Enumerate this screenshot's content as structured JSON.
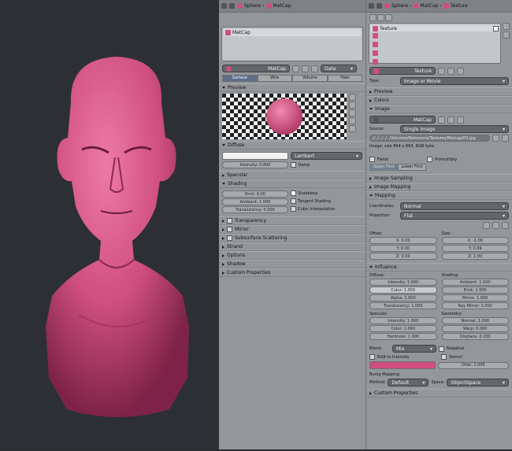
{
  "material_panel": {
    "crumbs": [
      "Sphere",
      "MatCap"
    ],
    "slot": "MatCap",
    "mat_name": "MatCap",
    "data": "Data",
    "tabs": [
      "Surface",
      "Wire",
      "Volume",
      "Halo"
    ],
    "preview": "Preview",
    "diffuse": "Diffuse",
    "diffuse_shader": "Lambert",
    "diffuse_intensity": "Intensity: 0.800",
    "ramp": "Ramp",
    "specular": "Specular",
    "shading": "Shading",
    "emit": "Emit: 0.00",
    "ambient": "Ambient: 1.000",
    "translucency": "Translucency: 0.000",
    "shadeless": "Shadeless",
    "tangent": "Tangent Shading",
    "cubic": "Cubic Interpolation",
    "sections": [
      "Transparency",
      "Mirror",
      "Subsurface Scattering",
      "Strand",
      "Options",
      "Shadow",
      "Custom Properties"
    ]
  },
  "texture_panel": {
    "crumbs": [
      "Sphere",
      "MatCap",
      "Texture"
    ],
    "slot": "Texture",
    "tex_name": "Texture",
    "type_label": "Type:",
    "type_value": "Image or Movie",
    "sec_preview": "Preview",
    "sec_colors": "Colors",
    "sec_image": "Image",
    "image_name": "MatCap",
    "source_label": "Source:",
    "source_value": "Single Image",
    "path": "//../../../../Volumes/Reference/Textures/Matcap/P2.jpg",
    "image_info": "Image: size 864 x 864, RGB byte",
    "fields": "Fields",
    "premultiply": "Premultiply",
    "upper_first": "Upper First",
    "lower_first": "Lower First",
    "sec_sampling": "Image Sampling",
    "sec_imap": "Image Mapping",
    "sec_mapping": "Mapping",
    "coords_label": "Coordinates:",
    "coords_value": "Normal",
    "proj_label": "Projection:",
    "proj_value": "Flat",
    "offset_label": "Offset:",
    "size_label": "Size:",
    "offset": [
      "X: 0.00",
      "Y: 0.00",
      "Z: 0.00"
    ],
    "size": [
      "X: -1.00",
      "Y: 0.99",
      "Z: 1.00"
    ],
    "sec_influence": "Influence",
    "diffuse_label": "Diffuse:",
    "shading_label": "Shading:",
    "diffuse": [
      "Intensity: 1.000",
      "Color: 1.000",
      "Alpha: 1.000",
      "Translucency: 1.000"
    ],
    "shading": [
      "Ambient: 1.000",
      "Emit: 1.000",
      "Mirror: 1.000",
      "Ray Mirror: 1.000"
    ],
    "specular_label": "Specular:",
    "geometry_label": "Geometry:",
    "specular": [
      "Intensity: 1.000",
      "Color: 1.000",
      "Hardness: 1.000"
    ],
    "geometry": [
      "Normal: 1.000",
      "Warp: 0.000",
      "Displace: 0.200"
    ],
    "blend_label": "Blend:",
    "blend_value": "Mix",
    "negative": "Negative",
    "rgb_intensity": "RGB to Intensity",
    "stencil": "Stencil",
    "dvar": "DVar: 1.000",
    "bump_label": "Bump Mapping:",
    "method_label": "Method:",
    "method_value": "Default",
    "space_label": "Space:",
    "space_value": "ObjectSpace",
    "custom": "Custom Properties"
  },
  "colors": {
    "pink": "#d14f7f",
    "head": "#cf4f7e"
  }
}
